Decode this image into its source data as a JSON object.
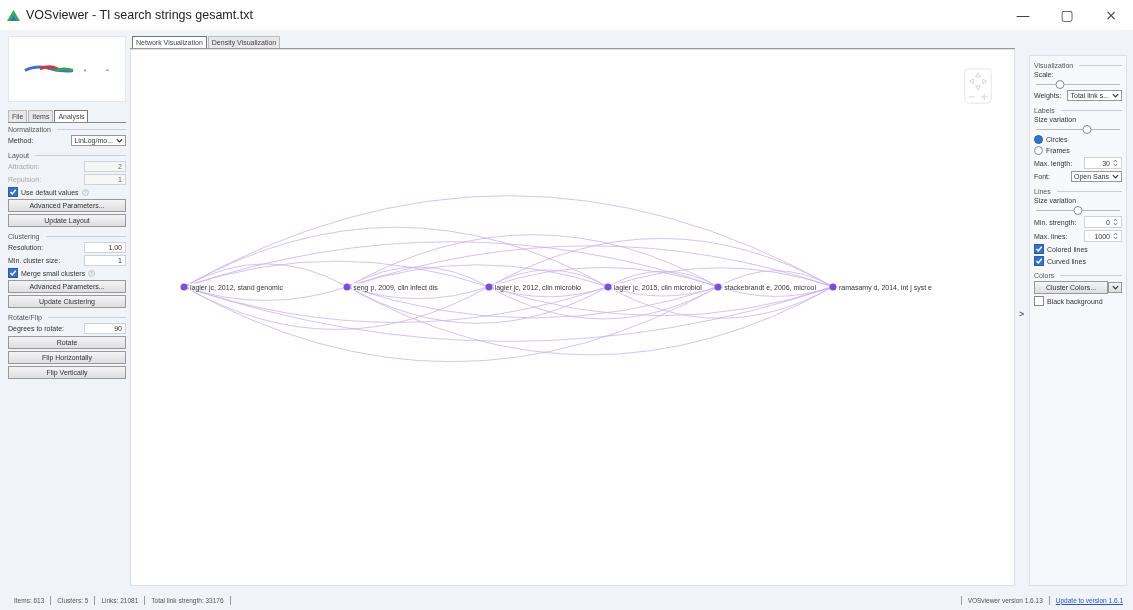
{
  "window": {
    "title": "VOSviewer - TI search strings gesamt.txt",
    "controls": [
      "—",
      "▢",
      "×"
    ]
  },
  "left_panel": {
    "tabs": [
      {
        "label": "File",
        "selected": false
      },
      {
        "label": "Items",
        "selected": false
      },
      {
        "label": "Analysis",
        "selected": true
      }
    ],
    "sections": [
      {
        "title": "Normalization",
        "controls": [
          {
            "kind": "select",
            "label": "Method:",
            "value": "LinLog/mo..."
          }
        ]
      },
      {
        "title": "Layout",
        "controls": [
          {
            "kind": "field",
            "label": "Attraction:",
            "value": "2",
            "disabled": true
          },
          {
            "kind": "field",
            "label": "Repulsion:",
            "value": "1",
            "disabled": true
          },
          {
            "kind": "checkbox",
            "label": "Use default values",
            "checked": true,
            "help": true
          },
          {
            "kind": "button",
            "label": "Advanced Parameters..."
          },
          {
            "kind": "button",
            "label": "Update Layout"
          }
        ]
      },
      {
        "title": "Clustering",
        "controls": [
          {
            "kind": "field",
            "label": "Resolution:",
            "value": "1.00",
            "disabled": false
          },
          {
            "kind": "field",
            "label": "Min. cluster size:",
            "value": "1",
            "disabled": false
          },
          {
            "kind": "checkbox",
            "label": "Merge small clusters",
            "checked": true,
            "help": true
          },
          {
            "kind": "button",
            "label": "Advanced Parameters..."
          },
          {
            "kind": "button",
            "label": "Update Clustering"
          }
        ]
      },
      {
        "title": "Rotate/Flip",
        "controls": [
          {
            "kind": "field",
            "label": "Degrees to rotate:",
            "value": "90",
            "disabled": false
          },
          {
            "kind": "button",
            "label": "Rotate"
          },
          {
            "kind": "button",
            "label": "Flip Horizontally"
          },
          {
            "kind": "button",
            "label": "Flip Vertically"
          }
        ]
      }
    ]
  },
  "view_tabs": [
    {
      "label": "Network Visualization",
      "selected": true
    },
    {
      "label": "Density Visualization",
      "selected": false
    }
  ],
  "network": {
    "nodes": [
      {
        "label": "lagier jc, 2012, stand genomic",
        "color": "#7b4fd6"
      },
      {
        "label": "seng p, 2009, clin infect dis",
        "color": "#7b4fd6"
      },
      {
        "label": "lagier jc, 2012, clin microbio",
        "color": "#7b4fd6"
      },
      {
        "label": "lagier jc, 2015, clin microbiol",
        "color": "#7b4fd6"
      },
      {
        "label": "stackebrandt e, 2006, microoi",
        "color": "#7b4fd6"
      },
      {
        "label": "ramasamy d, 2014, int j syst e",
        "color": "#7b4fd6"
      }
    ]
  },
  "panel_toggle": ">",
  "right_panel": {
    "sections": [
      {
        "title": "Visualization",
        "controls": [
          {
            "kind": "slider",
            "label": "Scale:",
            "level": 0.3
          },
          {
            "kind": "select",
            "label": "Weights:",
            "value": "Total link s..."
          }
        ]
      },
      {
        "title": "Labels",
        "controls": [
          {
            "kind": "slider",
            "label": "Size variation",
            "level": 0.6
          },
          {
            "kind": "radio",
            "label": "Circles",
            "selected": true
          },
          {
            "kind": "radio",
            "label": "Frames",
            "selected": false
          },
          {
            "kind": "spinner",
            "label": "Max. length:",
            "value": "30"
          },
          {
            "kind": "select",
            "label": "Font:",
            "value": "Open Sans"
          }
        ]
      },
      {
        "title": "Lines",
        "controls": [
          {
            "kind": "slider",
            "label": "Size variation",
            "level": 0.5
          },
          {
            "kind": "spinner",
            "label": "Min. strength:",
            "value": "0"
          },
          {
            "kind": "spinner",
            "label": "Max. lines:",
            "value": "1000"
          },
          {
            "kind": "checkbox",
            "label": "Colored lines",
            "checked": true
          },
          {
            "kind": "checkbox",
            "label": "Curved lines",
            "checked": true
          }
        ]
      },
      {
        "title": "Colors",
        "controls": [
          {
            "kind": "splitbutton",
            "label": "Cluster Colors..."
          },
          {
            "kind": "checkbox",
            "label": "Black background",
            "checked": false
          }
        ]
      }
    ]
  },
  "status_bar": {
    "left": [
      "Items: 613",
      "Clusters: 5",
      "Links: 21081",
      "Total link strength: 33176"
    ],
    "version": "VOSviewer version 1.6.13",
    "update_link": "Update to version 1.6.1"
  }
}
